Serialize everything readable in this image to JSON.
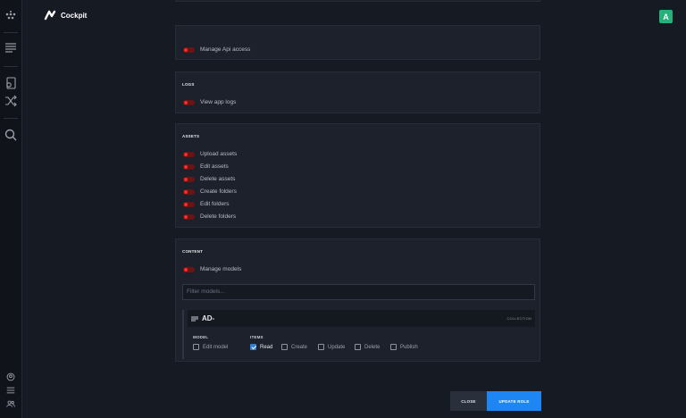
{
  "app": {
    "name": "Cockpit",
    "user_initial": "A"
  },
  "colors": {
    "accent": "#1d86f2",
    "toggle_off": "#ff2a2a",
    "avatar": "#28b07a",
    "checked": "#2e7fd6"
  },
  "sections": {
    "api": {
      "permissions": [
        "Manage Api access"
      ]
    },
    "logs": {
      "title": "LOGS",
      "permissions": [
        "View app logs"
      ]
    },
    "assets": {
      "title": "ASSETS",
      "permissions": [
        "Upload assets",
        "Edit assets",
        "Delete assets",
        "Create folders",
        "Edit folders",
        "Delete folders"
      ]
    },
    "content": {
      "title": "CONTENT",
      "permissions": [
        "Manage models"
      ],
      "filter_placeholder": "Filter models...",
      "model": {
        "name": "AD-",
        "type": "COLLECTION",
        "model_label": "MODEL",
        "items_label": "ITEMS",
        "edit_model": "Edit model",
        "items": [
          {
            "label": "Read",
            "checked": true
          },
          {
            "label": "Create",
            "checked": false
          },
          {
            "label": "Update",
            "checked": false
          },
          {
            "label": "Delete",
            "checked": false
          },
          {
            "label": "Publish",
            "checked": false
          }
        ]
      }
    }
  },
  "footer": {
    "close_label": "CLOSE",
    "update_label": "UPDATE ROLE"
  }
}
